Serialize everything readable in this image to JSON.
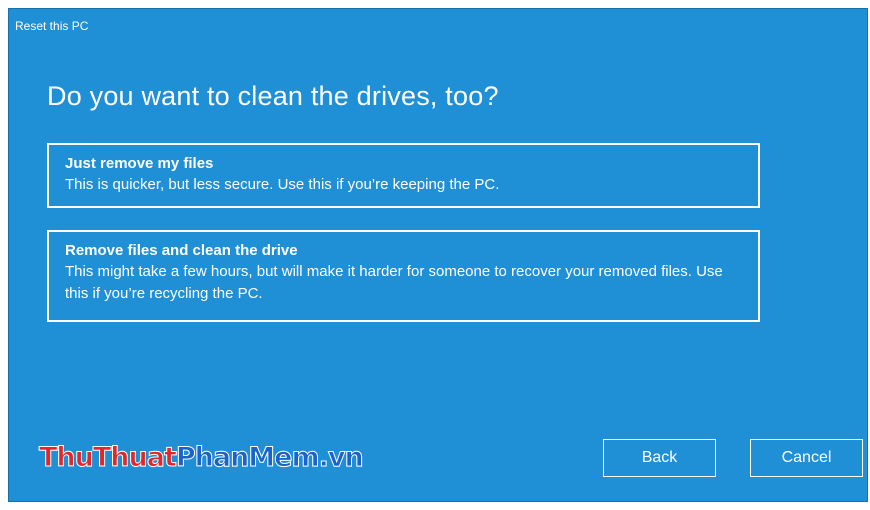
{
  "window": {
    "title": "Reset this PC"
  },
  "main": {
    "heading": "Do you want to clean the drives, too?",
    "options": [
      {
        "title": "Just remove my files",
        "description": "This is quicker, but less secure. Use this if you’re keeping the PC."
      },
      {
        "title": "Remove files and clean the drive",
        "description": "This might take a few hours, but will make it harder for someone to recover your removed files. Use this if you’re recycling the PC."
      }
    ]
  },
  "watermark": {
    "part1": "ThuThuat",
    "part2": "PhanMem",
    "part3": ".vn"
  },
  "footer": {
    "back_label": "Back",
    "cancel_label": "Cancel"
  },
  "colors": {
    "background": "#1f8fd6",
    "text": "#ffffff",
    "watermark_red": "#e3262b",
    "watermark_blue": "#1a63c9"
  }
}
